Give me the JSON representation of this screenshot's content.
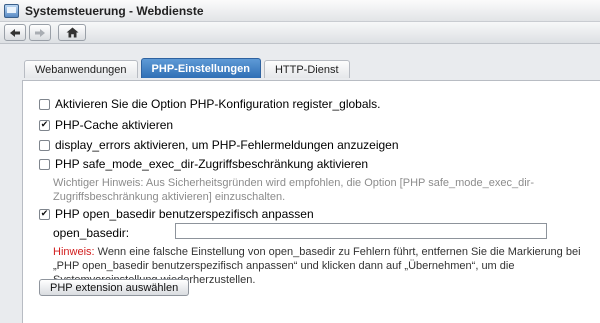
{
  "window": {
    "title": "Systemsteuerung - Webdienste"
  },
  "toolbar": {
    "back": "back",
    "forward": "forward",
    "home": "home"
  },
  "tabs": [
    {
      "label": "Webanwendungen",
      "active": false
    },
    {
      "label": "PHP-Einstellungen",
      "active": true
    },
    {
      "label": "HTTP-Dienst",
      "active": false
    }
  ],
  "options": {
    "register_globals": {
      "label": "Aktivieren Sie die Option PHP-Konfiguration register_globals.",
      "checked": false
    },
    "php_cache": {
      "label": "PHP-Cache aktivieren",
      "checked": true
    },
    "display_errors": {
      "label": "display_errors aktivieren, um PHP-Fehlermeldungen anzuzeigen",
      "checked": false
    },
    "safe_mode": {
      "label": "PHP safe_mode_exec_dir-Zugriffsbeschränkung aktivieren",
      "checked": false
    },
    "open_basedir": {
      "label": "PHP open_basedir benutzerspezifisch anpassen",
      "checked": true
    }
  },
  "safe_mode_hint": "Wichtiger Hinweis: Aus Sicherheitsgründen wird empfohlen, die Option [PHP safe_mode_exec_dir-Zugriffsbeschränkung aktivieren] einzuschalten.",
  "open_basedir_field": {
    "label": "open_basedir:",
    "value": ""
  },
  "open_basedir_hint": {
    "prefix": "Hinweis:",
    "text": " Wenn eine falsche Einstellung von open_basedir zu Fehlern führt, entfernen Sie die Markierung bei „PHP open_basedir benutzerspezifisch anpassen“ und klicken dann auf „Übernehmen“, um die Systemvoreinstellung wiederherzustellen."
  },
  "extension_button": "PHP extension auswählen"
}
